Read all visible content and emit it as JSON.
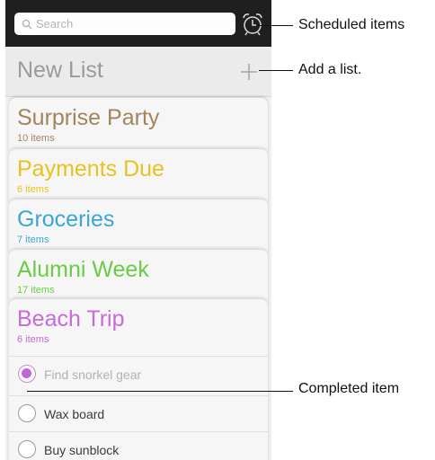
{
  "search": {
    "placeholder": "Search",
    "icon": "search-icon"
  },
  "header": {
    "scheduled_icon": "alarm-clock-icon",
    "new_list_label": "New List",
    "add_icon": "plus-icon"
  },
  "lists": [
    {
      "title": "Surprise Party",
      "count": "10 items",
      "color": "#a3845f"
    },
    {
      "title": "Payments Due",
      "count": "6 items",
      "color": "#e8c21e"
    },
    {
      "title": "Groceries",
      "count": "7 items",
      "color": "#3aa6d8"
    },
    {
      "title": "Alumni Week",
      "count": "17 items",
      "color": "#6ccb46"
    },
    {
      "title": "Beach Trip",
      "count": "6 items",
      "color": "#c86ad8"
    }
  ],
  "items": [
    {
      "label": "Find snorkel gear",
      "completed": true
    },
    {
      "label": "Wax board",
      "completed": false
    },
    {
      "label": "Buy sunblock",
      "completed": false
    }
  ],
  "callouts": {
    "scheduled": "Scheduled items",
    "add_list": "Add a list.",
    "completed": "Completed item"
  }
}
